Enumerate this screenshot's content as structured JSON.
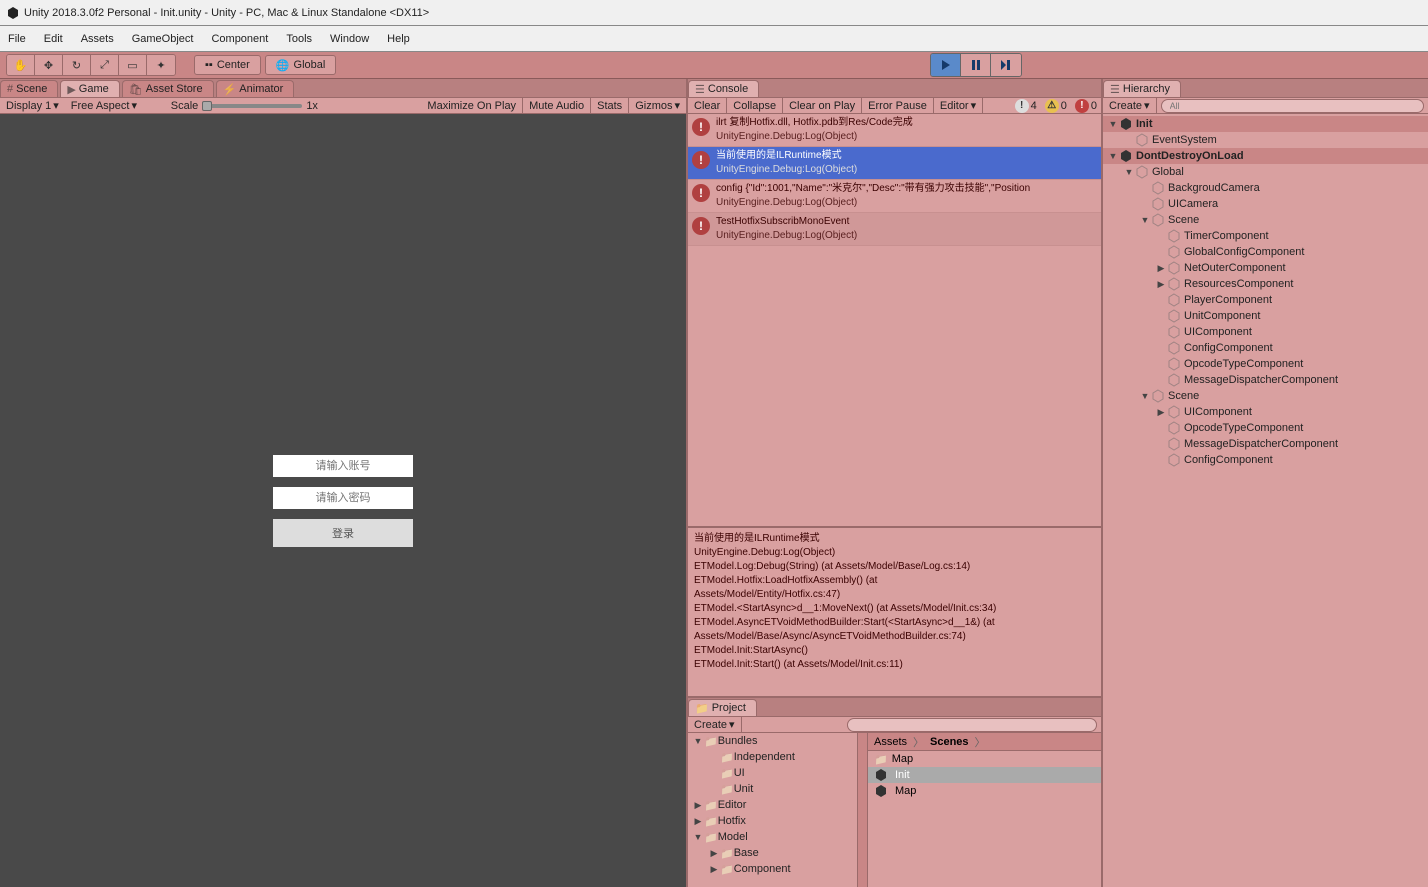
{
  "title": "Unity 2018.3.0f2 Personal - Init.unity - Unity - PC, Mac & Linux Standalone <DX11>",
  "menu": [
    "File",
    "Edit",
    "Assets",
    "GameObject",
    "Component",
    "Tools",
    "Window",
    "Help"
  ],
  "toolbar": {
    "center": "Center",
    "global": "Global"
  },
  "tabs": {
    "left": [
      {
        "l": "Scene",
        "i": "#"
      },
      {
        "l": "Game",
        "i": "▶"
      },
      {
        "l": "Asset Store",
        "i": "🛍"
      },
      {
        "l": "Animator",
        "i": "⚡"
      }
    ],
    "center": [
      {
        "l": "Console",
        "i": "☰"
      }
    ],
    "right": [
      {
        "l": "Hierarchy",
        "i": "☰"
      }
    ]
  },
  "gamebar": {
    "display": "Display 1",
    "aspect": "Free Aspect",
    "scale": "Scale",
    "scaleVal": "1x",
    "max": "Maximize On Play",
    "mute": "Mute Audio",
    "stats": "Stats",
    "gizmos": "Gizmos"
  },
  "login": {
    "user": "请输入账号",
    "pass": "请输入密码",
    "btn": "登录"
  },
  "consolebar": {
    "clear": "Clear",
    "collapse": "Collapse",
    "clearPlay": "Clear on Play",
    "errorPause": "Error Pause",
    "editor": "Editor",
    "info": "4",
    "warn": "0",
    "err": "0"
  },
  "console": [
    {
      "t": "ilrt 复制Hotfix.dll, Hotfix.pdb到Res/Code完成",
      "s": "UnityEngine.Debug:Log(Object)"
    },
    {
      "t": "当前使用的是ILRuntime模式",
      "s": "UnityEngine.Debug:Log(Object)",
      "sel": true
    },
    {
      "t": "config {\"Id\":1001,\"Name\":\"米克尔\",\"Desc\":\"带有强力攻击技能\",\"Position",
      "s": "UnityEngine.Debug:Log(Object)"
    },
    {
      "t": "TestHotfixSubscribMonoEvent",
      "s": "UnityEngine.Debug:Log(Object)"
    }
  ],
  "consoleDetail": "当前使用的是ILRuntime模式\nUnityEngine.Debug:Log(Object)\nETModel.Log:Debug(String) (at Assets/Model/Base/Log.cs:14)\nETModel.Hotfix:LoadHotfixAssembly() (at\nAssets/Model/Entity/Hotfix.cs:47)\nETModel.<StartAsync>d__1:MoveNext() (at Assets/Model/Init.cs:34)\nETModel.AsyncETVoidMethodBuilder:Start(<StartAsync>d__1&) (at\nAssets/Model/Base/Async/AsyncETVoidMethodBuilder.cs:74)\nETModel.Init:StartAsync()\nETModel.Init:Start() (at Assets/Model/Init.cs:11)",
  "hierarchyBar": {
    "create": "Create",
    "search": "All"
  },
  "hierarchy": [
    {
      "d": 0,
      "i": "u",
      "l": "Init",
      "h": true,
      "f": "▼"
    },
    {
      "d": 1,
      "i": "c",
      "l": "EventSystem"
    },
    {
      "d": 0,
      "i": "u",
      "l": "DontDestroyOnLoad",
      "h": true,
      "f": "▼"
    },
    {
      "d": 1,
      "i": "c",
      "l": "Global",
      "f": "▼"
    },
    {
      "d": 2,
      "i": "c",
      "l": "BackgroudCamera"
    },
    {
      "d": 2,
      "i": "c",
      "l": "UICamera"
    },
    {
      "d": 2,
      "i": "c",
      "l": "Scene",
      "f": "▼"
    },
    {
      "d": 3,
      "i": "c",
      "l": "TimerComponent"
    },
    {
      "d": 3,
      "i": "c",
      "l": "GlobalConfigComponent"
    },
    {
      "d": 3,
      "i": "c",
      "l": "NetOuterComponent",
      "f": "▶"
    },
    {
      "d": 3,
      "i": "c",
      "l": "ResourcesComponent",
      "f": "▶"
    },
    {
      "d": 3,
      "i": "c",
      "l": "PlayerComponent"
    },
    {
      "d": 3,
      "i": "c",
      "l": "UnitComponent"
    },
    {
      "d": 3,
      "i": "c",
      "l": "UIComponent"
    },
    {
      "d": 3,
      "i": "c",
      "l": "ConfigComponent"
    },
    {
      "d": 3,
      "i": "c",
      "l": "OpcodeTypeComponent"
    },
    {
      "d": 3,
      "i": "c",
      "l": "MessageDispatcherComponent"
    },
    {
      "d": 2,
      "i": "c",
      "l": "Scene",
      "f": "▼"
    },
    {
      "d": 3,
      "i": "c",
      "l": "UIComponent",
      "f": "▶"
    },
    {
      "d": 3,
      "i": "c",
      "l": "OpcodeTypeComponent"
    },
    {
      "d": 3,
      "i": "c",
      "l": "MessageDispatcherComponent"
    },
    {
      "d": 3,
      "i": "c",
      "l": "ConfigComponent"
    }
  ],
  "projectbar": {
    "create": "Create"
  },
  "projectTabs": [
    {
      "l": "Project",
      "i": "📁"
    }
  ],
  "breadcrumb": [
    "Assets",
    "Scenes"
  ],
  "projectTree": [
    {
      "d": 0,
      "l": "Bundles",
      "f": "▼"
    },
    {
      "d": 1,
      "l": "Independent"
    },
    {
      "d": 1,
      "l": "UI"
    },
    {
      "d": 1,
      "l": "Unit"
    },
    {
      "d": 0,
      "l": "Editor",
      "f": "▶"
    },
    {
      "d": 0,
      "l": "Hotfix",
      "f": "▶"
    },
    {
      "d": 0,
      "l": "Model",
      "f": "▼"
    },
    {
      "d": 1,
      "l": "Base",
      "f": "▶"
    },
    {
      "d": 1,
      "l": "Component",
      "f": "▶"
    }
  ],
  "assets": [
    {
      "l": "Map",
      "i": "f"
    },
    {
      "l": "Init",
      "i": "u",
      "sel": true
    },
    {
      "l": "Map",
      "i": "u"
    }
  ]
}
